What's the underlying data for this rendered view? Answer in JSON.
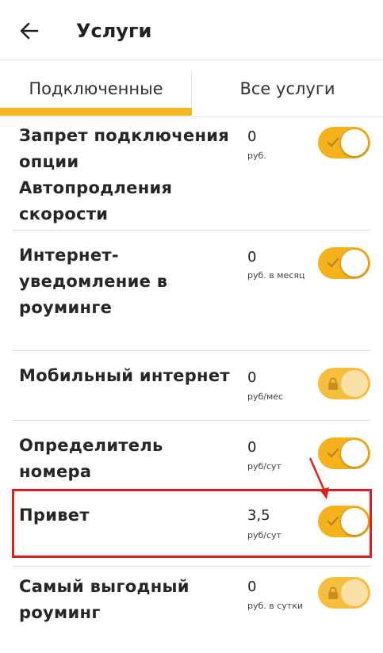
{
  "header": {
    "title": "Услуги",
    "back_icon": "arrow-left-icon"
  },
  "tabs": [
    {
      "label": "Подключенные",
      "active": true
    },
    {
      "label": "Все услуги",
      "active": false
    }
  ],
  "accent_color": "#f2b826",
  "services": [
    {
      "name": "Запрет подключения опции Автопродления скорости",
      "price": "0",
      "unit": "руб.",
      "enabled": true,
      "locked": false
    },
    {
      "name": "Интернет-уведомление в роуминге",
      "price": "0",
      "unit": "руб. в месяц",
      "enabled": true,
      "locked": false
    },
    {
      "name": "Мобильный интернет",
      "price": "0",
      "unit": "руб/мес",
      "enabled": true,
      "locked": true
    },
    {
      "name": "Определитель номера",
      "price": "0",
      "unit": "руб/сут",
      "enabled": true,
      "locked": false
    },
    {
      "name": "Привет",
      "price": "3,5",
      "unit": "руб/сут",
      "enabled": true,
      "locked": false
    },
    {
      "name": "Самый выгодный роуминг",
      "price": "0",
      "unit": "руб. в сутки",
      "enabled": true,
      "locked": true
    }
  ],
  "annotation": {
    "color": "#e0201d",
    "highlighted_service": "Привет"
  }
}
